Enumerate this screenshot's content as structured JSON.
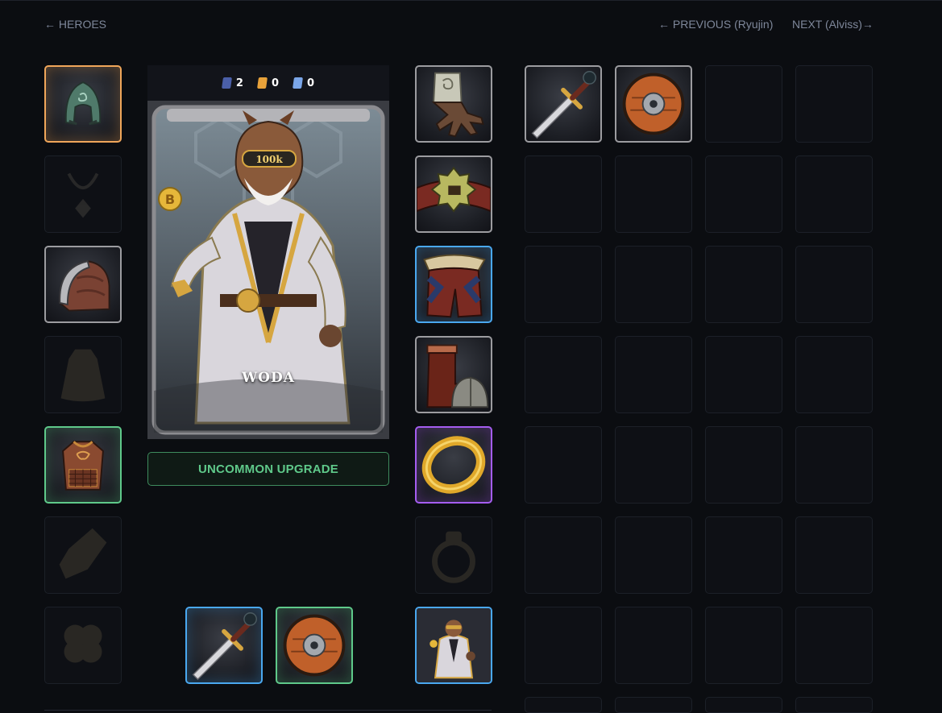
{
  "nav": {
    "back_label": "HEROES",
    "previous_label": "PREVIOUS (Ryujin)",
    "next_label": "NEXT (Alviss)"
  },
  "hero": {
    "name": "WODA",
    "stats": [
      {
        "icon": "blue-gem-icon",
        "value": "2",
        "color": "#4a5fa8"
      },
      {
        "icon": "orange-gem-icon",
        "value": "0",
        "color": "#e8a23a"
      },
      {
        "icon": "light-blue-gem-icon",
        "value": "0",
        "color": "#7aa6e8"
      }
    ],
    "upgrade_label": "UNCOMMON UPGRADE",
    "upgrade_color": "#5fc98a"
  },
  "left_slots": [
    {
      "item": "helmet-icon",
      "rarity": "legendary"
    },
    {
      "item": "amulet-icon",
      "rarity": "empty"
    },
    {
      "item": "shoulder-armor-icon",
      "rarity": "common"
    },
    {
      "item": "cape-icon",
      "rarity": "empty"
    },
    {
      "item": "chest-armor-icon",
      "rarity": "uncommon"
    },
    {
      "item": "bracer-icon",
      "rarity": "empty"
    },
    {
      "item": "clover-icon",
      "rarity": "empty"
    }
  ],
  "right_slots": [
    {
      "item": "gloves-icon",
      "rarity": "common"
    },
    {
      "item": "belt-icon",
      "rarity": "common"
    },
    {
      "item": "pants-icon",
      "rarity": "rare"
    },
    {
      "item": "boots-icon",
      "rarity": "common"
    },
    {
      "item": "gold-ring-icon",
      "rarity": "epic"
    },
    {
      "item": "ring-icon",
      "rarity": "empty"
    },
    {
      "item": "hero-skin-icon",
      "rarity": "rare"
    }
  ],
  "weapon_slots": [
    {
      "item": "sword-icon",
      "rarity": "rare"
    },
    {
      "item": "shield-icon",
      "rarity": "uncommon"
    }
  ],
  "inventory": [
    {
      "item": "sword-icon",
      "rarity": "common"
    },
    {
      "item": "shield-icon",
      "rarity": "common"
    }
  ],
  "colors": {
    "background": "#0b0d11",
    "common": "#9c9ca0",
    "uncommon": "#5fc98a",
    "rare": "#4aa8f0",
    "epic": "#a55df0",
    "legendary": "#f0a65a"
  }
}
